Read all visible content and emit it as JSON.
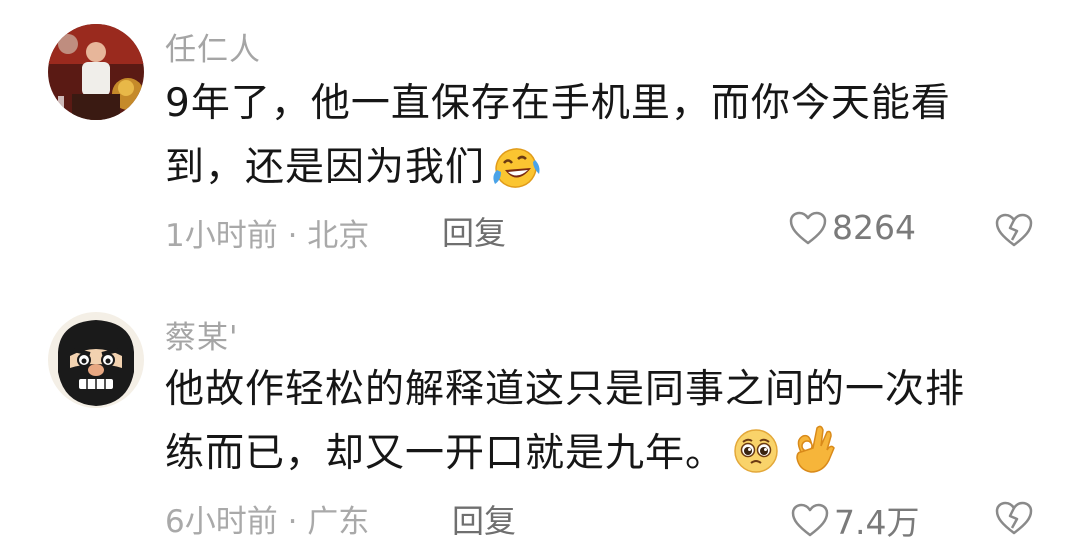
{
  "comments": [
    {
      "username": "任仁人",
      "text_lines": [
        "9年了，他一直保存在手机里，而你今天能看",
        "到，还是因为我们"
      ],
      "emoji": "laughing-tears-emoji",
      "meta": "1小时前 · 北京",
      "reply_label": "回复",
      "likes": "8264"
    },
    {
      "username": "蔡某'",
      "text_lines": [
        "他故作轻松的解释道这只是同事之间的一次排",
        "练而已，却又一开口就是九年。"
      ],
      "emojis": [
        "pleading-face-emoji",
        "ok-hand-emoji"
      ],
      "meta": "6小时前 · 广东",
      "reply_label": "回复",
      "likes": "7.4万"
    }
  ],
  "colors": {
    "text": "#161616",
    "meta": "#a9a9a9",
    "reply": "#6f6f6f",
    "icon": "#8a8a8a"
  }
}
